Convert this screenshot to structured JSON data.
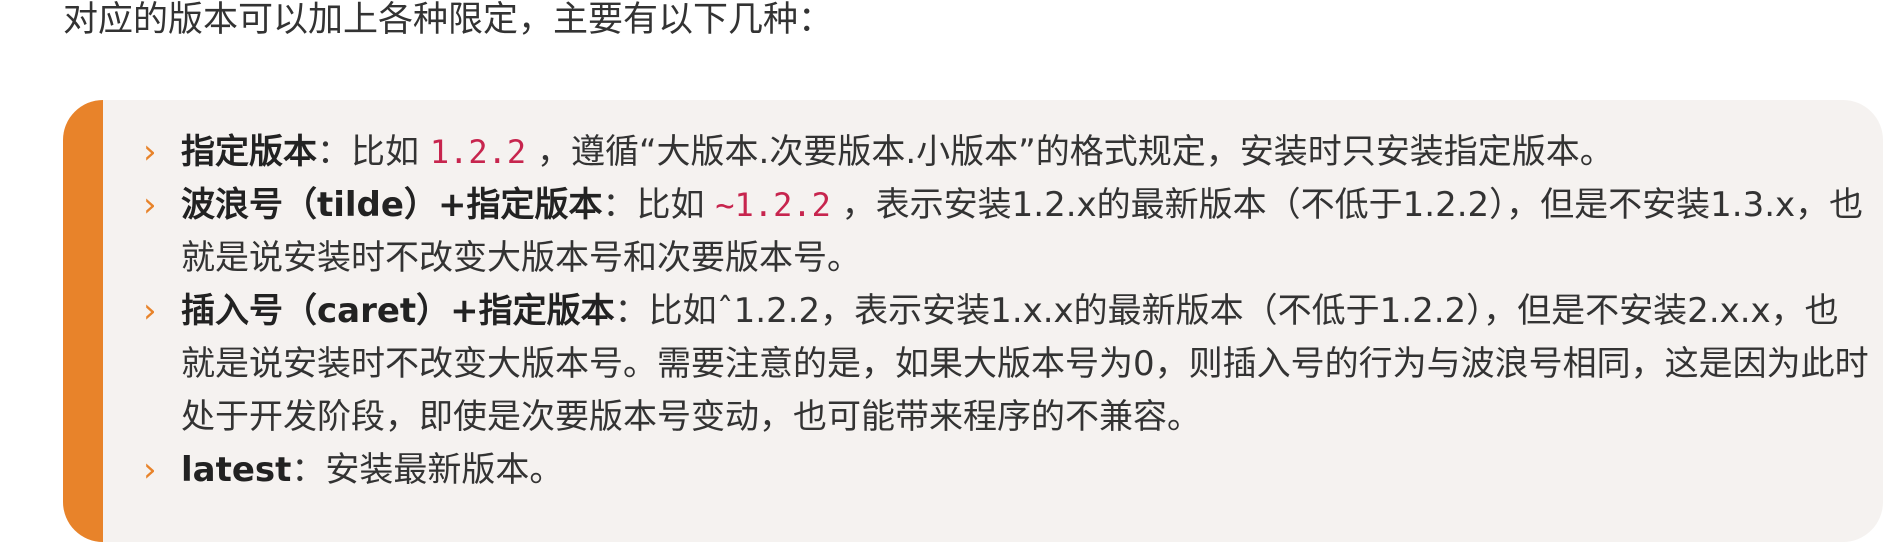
{
  "intro": "对应的版本可以加上各种限定，主要有以下几种：",
  "items": [
    {
      "term": "指定版本",
      "sep": "：",
      "before": "比如 ",
      "code": "1.2.2",
      "after": " ，遵循“大版本.次要版本.小版本”的格式规定，安装时只安装指定版本。"
    },
    {
      "term": "波浪号（tilde）+指定版本",
      "sep": "：",
      "before": "比如 ",
      "code": "~1.2.2",
      "after": " ，表示安装1.2.x的最新版本（不低于1.2.2），但是不安装1.3.x，也就是说安装时不改变大版本号和次要版本号。"
    },
    {
      "term": "插入号（caret）+指定版本",
      "sep": "：",
      "text": "比如ˆ1.2.2，表示安装1.x.x的最新版本（不低于1.2.2），但是不安装2.x.x，也就是说安装时不改变大版本号。需要注意的是，如果大版本号为0，则插入号的行为与波浪号相同，这是因为此时处于开发阶段，即使是次要版本号变动，也可能带来程序的不兼容。"
    },
    {
      "term": "latest",
      "sep": "：",
      "text": "安装最新版本。"
    }
  ],
  "bullet_glyph": "›",
  "colors": {
    "accent": "#e8832a",
    "box_background": "#f5f2f0",
    "code_text": "#c7254e",
    "body_text": "#333333"
  },
  "icons": {
    "bullet": "chevron-right-icon"
  }
}
